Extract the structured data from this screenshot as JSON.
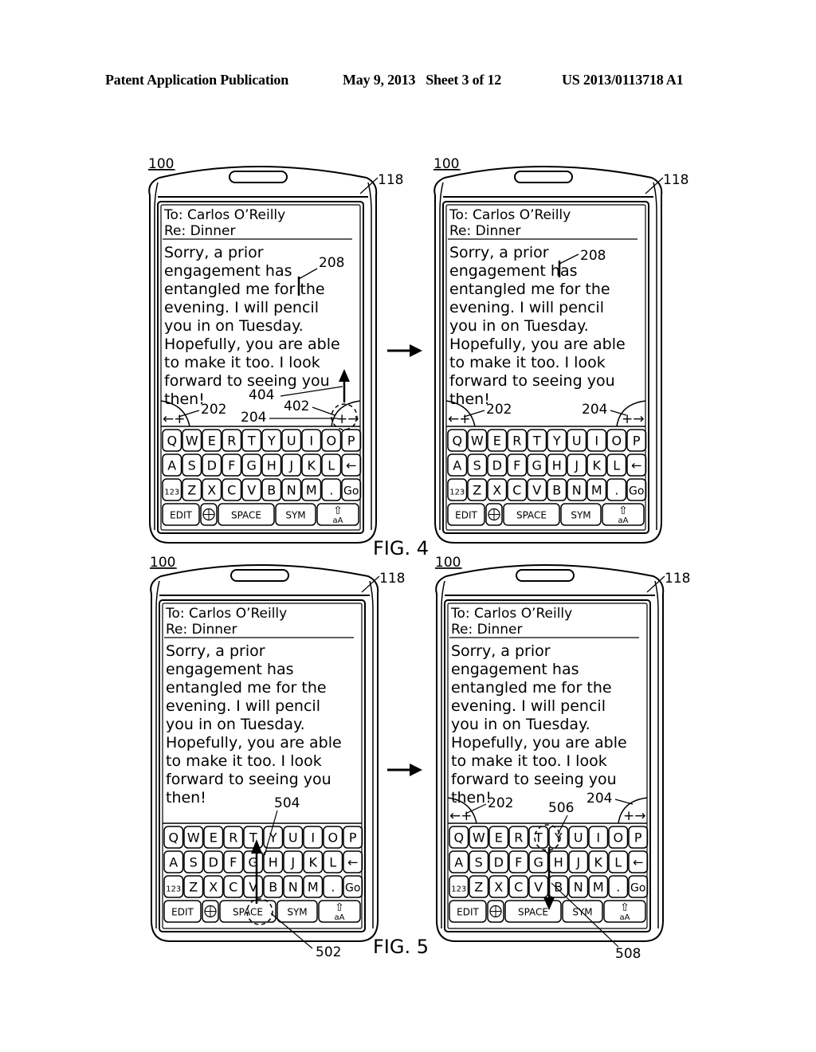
{
  "header": {
    "publication": "Patent Application Publication",
    "date_sheet": "May 9, 2013   Sheet 3 of 12",
    "number": "US 2013/0113718 A1"
  },
  "figure_labels": [
    "FIG. 4",
    "FIG. 5"
  ],
  "message": {
    "to_label": "To:",
    "to_value": "Carlos O’Reilly",
    "re_label": "Re:",
    "re_value": "Dinner",
    "body_lines": [
      "Sorry, a prior",
      "engagement has",
      "entangled me for the",
      "evening. I will pencil",
      "you in on Tuesday.",
      "Hopefully, you are able",
      "to make it too. I look",
      "forward to seeing you",
      "then!"
    ]
  },
  "keyboard": {
    "rows": [
      [
        "Q",
        "W",
        "E",
        "R",
        "T",
        "Y",
        "U",
        "I",
        "O",
        "P"
      ],
      [
        "A",
        "S",
        "D",
        "F",
        "G",
        "H",
        "J",
        "K",
        "L",
        "←"
      ],
      [
        "123",
        "Z",
        "X",
        "C",
        "V",
        "B",
        "N",
        "M",
        ".",
        "Go"
      ]
    ],
    "bottom_row": [
      "EDIT",
      "globe",
      "SPACE",
      "SYM",
      "shift"
    ],
    "shift_sub": "aA",
    "left_arrow": "←+",
    "right_arrow": "+→"
  },
  "reference_numerals": {
    "device": "100",
    "screen": "118",
    "cursor": "208",
    "left_area": "202",
    "right_area": "204",
    "touch_402": "402",
    "gesture_404": "404",
    "touch_502": "502",
    "gesture_504": "504",
    "touch_506": "506",
    "gesture_508": "508"
  },
  "panels": [
    {
      "id": "fig4-left",
      "figure": "FIG. 4",
      "cursor_after": "for",
      "show_side_keys": true,
      "annotations": [
        "100",
        "118",
        "208",
        "202",
        "204",
        "402",
        "404"
      ]
    },
    {
      "id": "fig4-right",
      "figure": "FIG. 4",
      "cursor_after": "has",
      "show_side_keys": true,
      "annotations": [
        "100",
        "118",
        "208",
        "202",
        "204"
      ]
    },
    {
      "id": "fig5-left",
      "figure": "FIG. 5",
      "cursor_after": null,
      "show_side_keys": false,
      "annotations": [
        "100",
        "118",
        "502",
        "504"
      ]
    },
    {
      "id": "fig5-right",
      "figure": "FIG. 5",
      "cursor_after": null,
      "show_side_keys": true,
      "annotations": [
        "100",
        "118",
        "202",
        "204",
        "506",
        "508"
      ]
    }
  ]
}
